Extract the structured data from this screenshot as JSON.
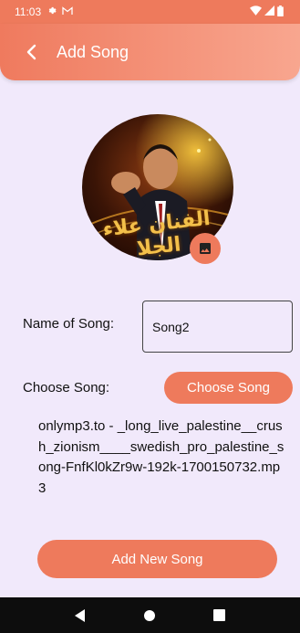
{
  "status_bar": {
    "time": "11:03",
    "icons": [
      "settings-icon",
      "gmail-icon",
      "wifi-icon",
      "signal-icon",
      "battery-icon"
    ]
  },
  "app_bar": {
    "title": "Add Song",
    "back_icon": "chevron-left-icon"
  },
  "cover": {
    "alt": "song cover image",
    "overlay_text": "الفنان علاء الجلا"
  },
  "form": {
    "name_label": "Name of Song:",
    "name_value": "Song2",
    "choose_label": "Choose Song:",
    "choose_button": "Choose Song",
    "selected_file": "onlymp3.to - _long_live_palestine__crush_zionism____swedish_pro_palestine_song-FnfKl0kZr9w-192k-1700150732.mp3"
  },
  "add_button": "Add New Song",
  "nav": [
    "back-icon",
    "home-icon",
    "recents-icon"
  ],
  "colors": {
    "accent": "#ee7a5c",
    "background": "#f1e9fb",
    "navbar": "#0d0d0d"
  }
}
